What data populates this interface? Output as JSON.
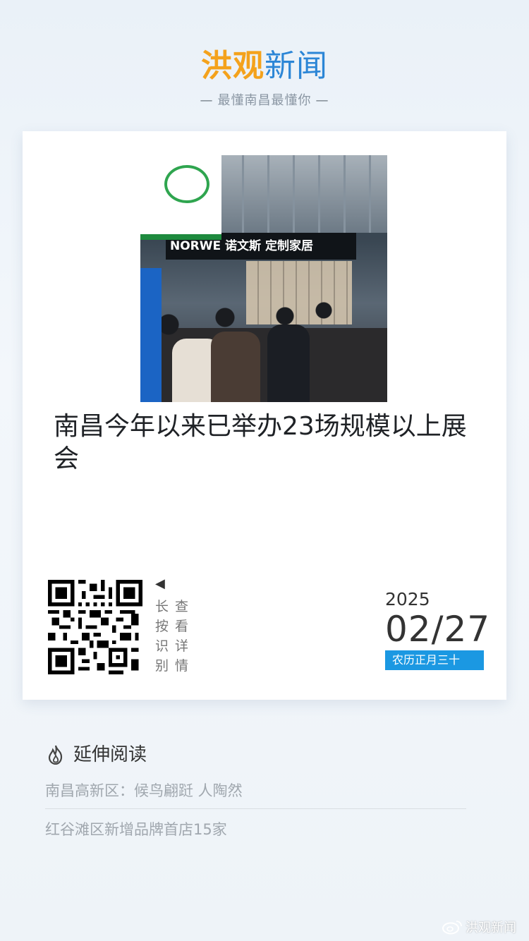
{
  "brand": {
    "logo_part1": "洪观",
    "logo_part2": "新闻",
    "slogan": "最懂南昌最懂你"
  },
  "article": {
    "headline": "南昌今年以来已举办23场规模以上展会",
    "photo_sign_text": "NORWE 诺文斯 定制家居"
  },
  "qr_hint": {
    "arrow": "◀",
    "col1": "长按识别",
    "col2": "查看详情"
  },
  "date": {
    "year": "2025",
    "month": "02",
    "slash": "/",
    "day": "27",
    "lunar": "农历正月三十"
  },
  "related": {
    "title": "延伸阅读",
    "items": [
      "南昌高新区：候鸟翩跹 人陶然",
      "红谷滩区新增品牌首店15家"
    ]
  },
  "watermark": {
    "text": "洪观新闻"
  },
  "colors": {
    "accent_blue": "#1b98e2",
    "brand_orange": "#f4a21c",
    "brand_blue": "#1f8fdc"
  }
}
